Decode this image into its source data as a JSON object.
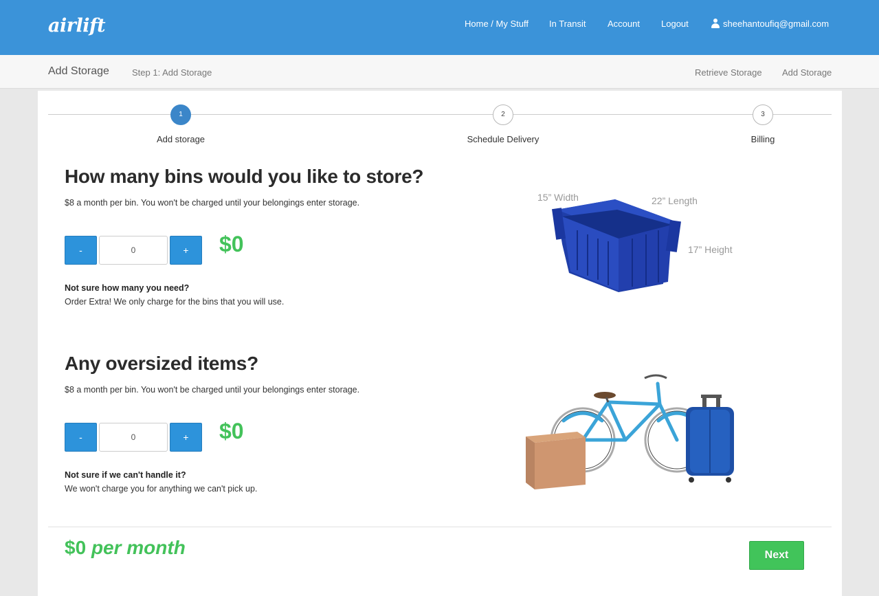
{
  "header": {
    "logo": "airlift",
    "nav": [
      "Home / My Stuff",
      "In Transit",
      "Account",
      "Logout"
    ],
    "user_email": "sheehantoufiq@gmail.com"
  },
  "subheader": {
    "title": "Add Storage",
    "step": "Step 1: Add Storage",
    "links": [
      "Retrieve Storage",
      "Add Storage"
    ]
  },
  "steps": [
    {
      "number": "1",
      "label": "Add storage",
      "active": true
    },
    {
      "number": "2",
      "label": "Schedule Delivery",
      "active": false
    },
    {
      "number": "3",
      "label": "Billing",
      "active": false
    }
  ],
  "bins": {
    "heading": "How many bins would you like to store?",
    "description": "$8 a month per bin. You won't be charged until your belongings enter storage.",
    "minus": "-",
    "plus": "+",
    "quantity": "0",
    "price": "$0",
    "note_title": "Not sure how many you need?",
    "note_text": "Order Extra! We only charge for the bins that you will use.",
    "dimensions": {
      "width": "15” Width",
      "length": "22” Length",
      "height": "17” Height"
    }
  },
  "oversized": {
    "heading": "Any oversized items?",
    "description": "$8 a month per bin. You won't be charged until your belongings enter storage.",
    "minus": "-",
    "plus": "+",
    "quantity": "0",
    "price": "$0",
    "note_title": "Not sure if we can't handle it?",
    "note_text": "We won't charge you for anything we can't pick up."
  },
  "footer": {
    "total": "$0",
    "per_month": "per month",
    "next": "Next"
  },
  "colors": {
    "brand_blue": "#3b93d9",
    "button_blue": "#2d93db",
    "green": "#43c25a"
  }
}
